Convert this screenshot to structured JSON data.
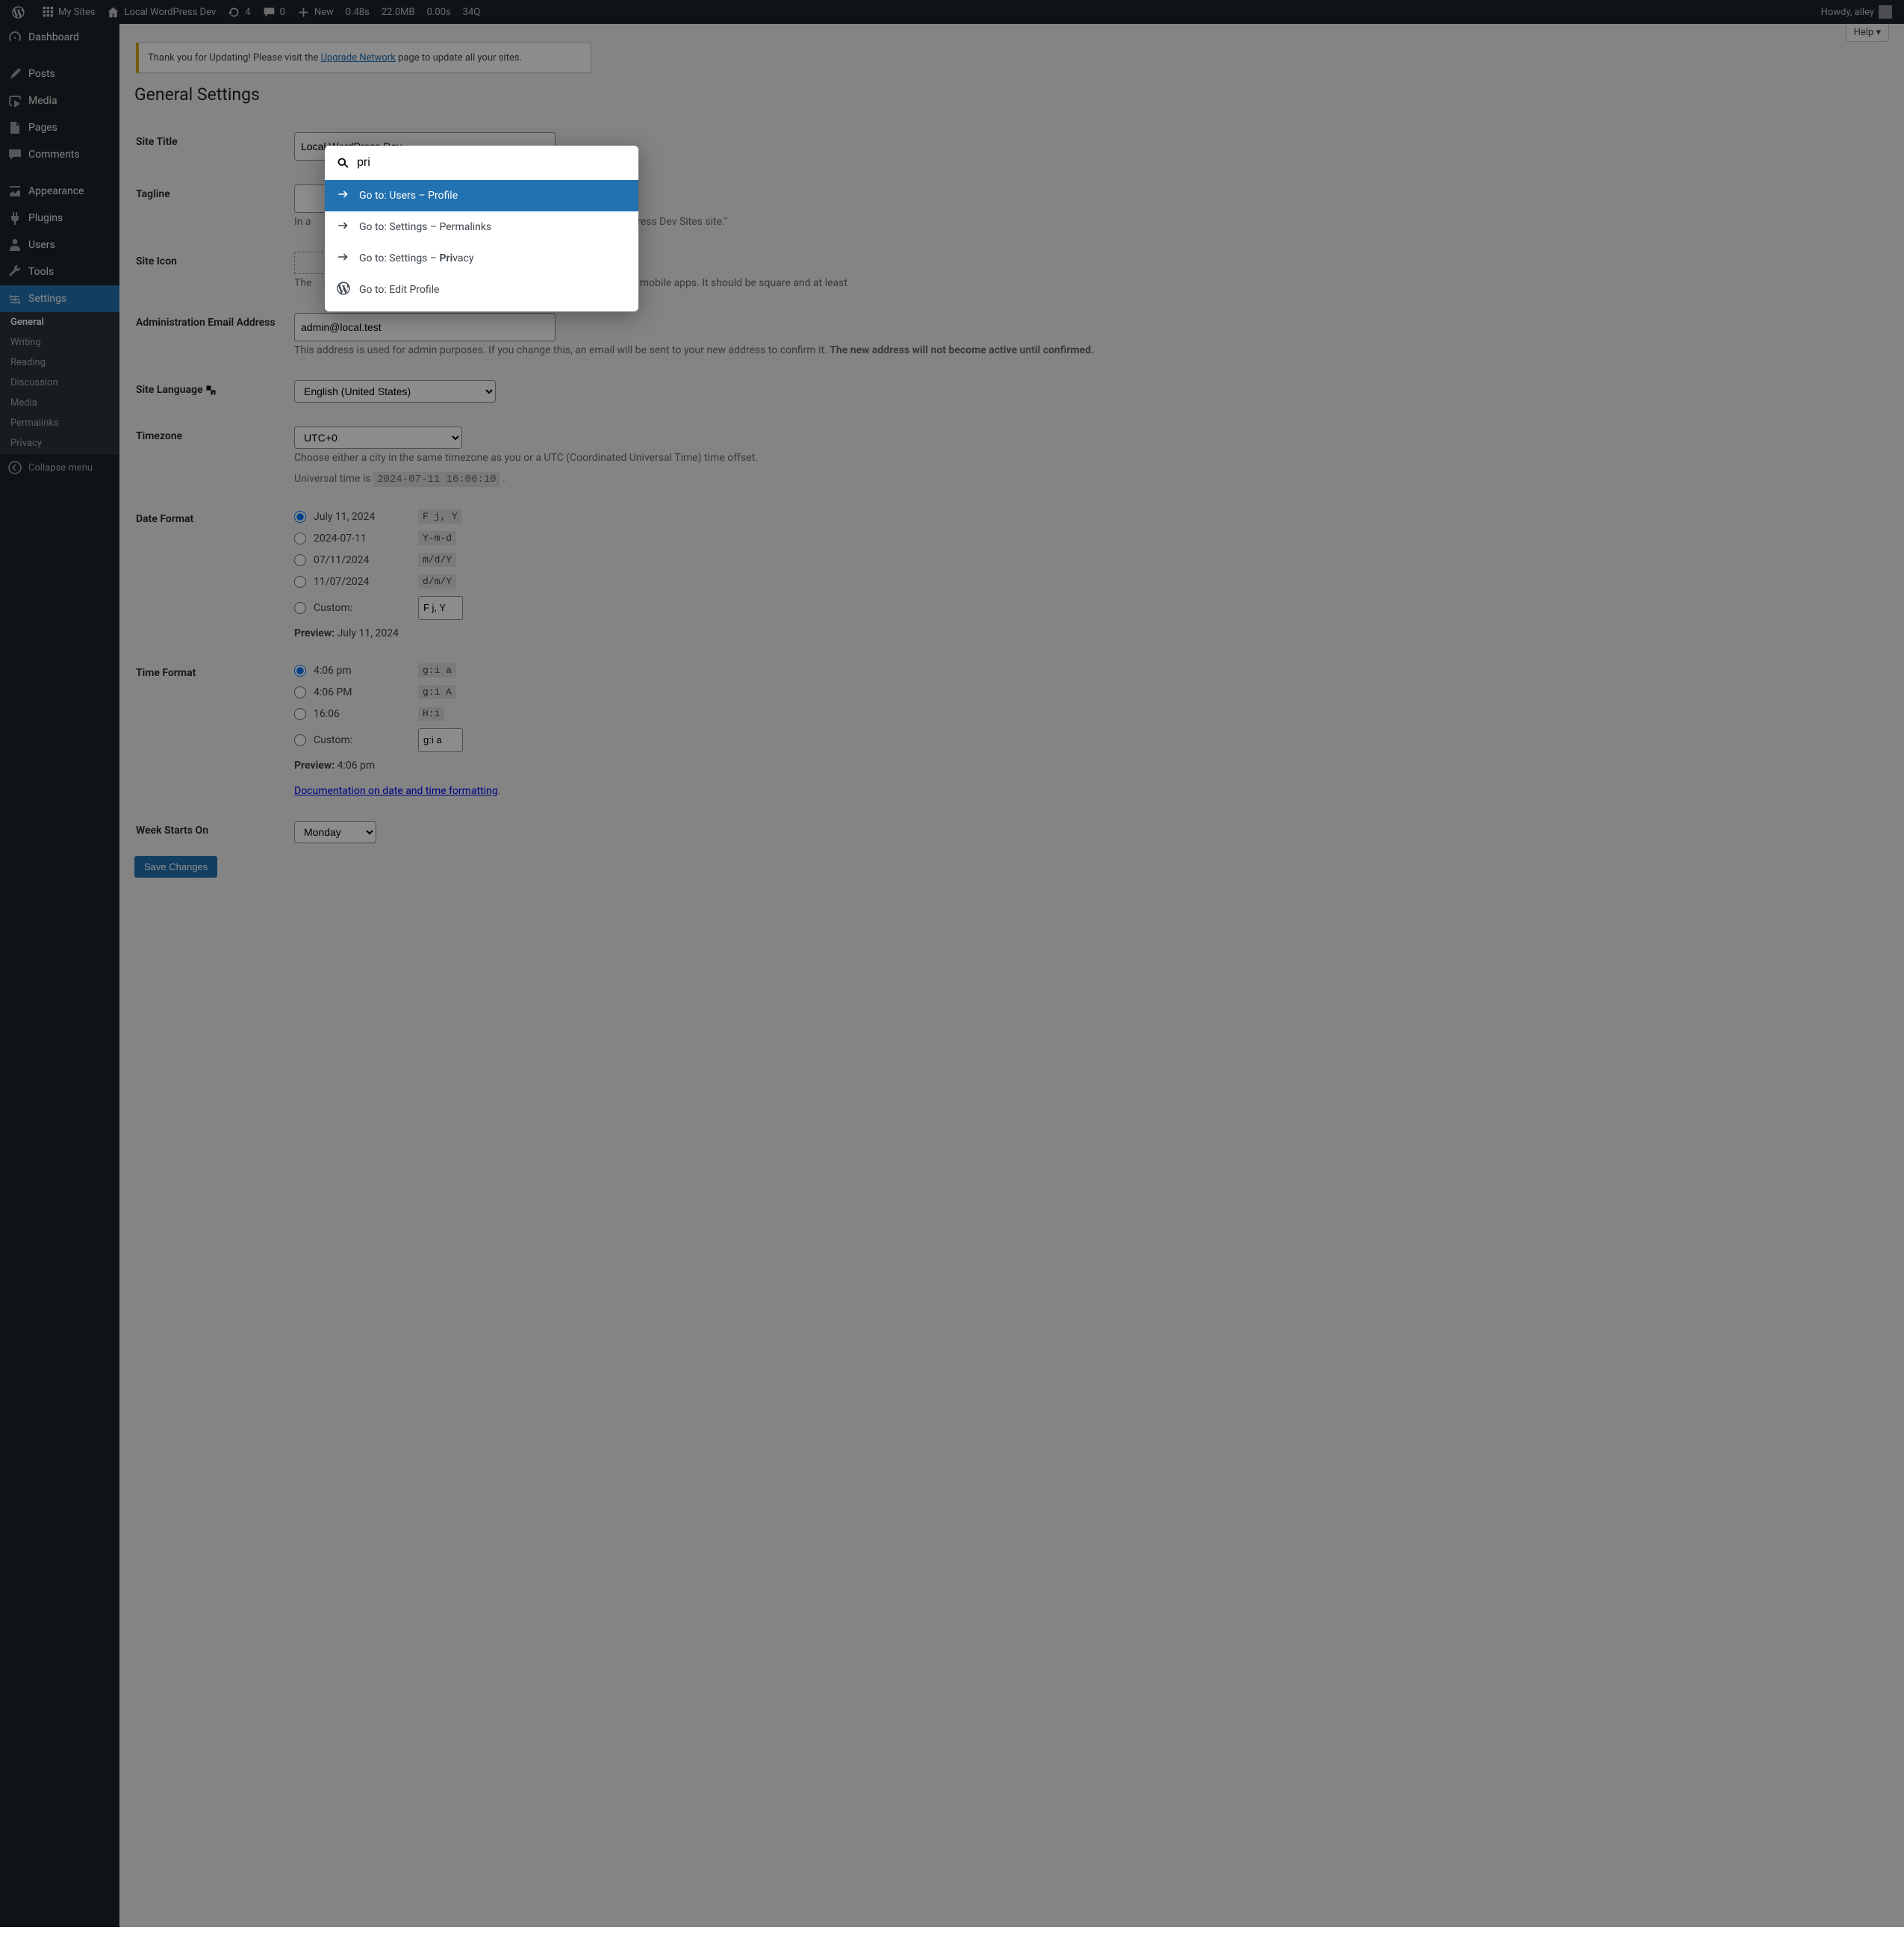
{
  "adminbar": {
    "my_sites": "My Sites",
    "site_name": "Local WordPress Dev",
    "updates_count": "4",
    "comments_count": "0",
    "new_label": "New",
    "perf_time": "0.48s",
    "perf_mem": "22.0MB",
    "perf_time2": "0.00s",
    "perf_q": "34Q",
    "howdy": "Howdy, alley"
  },
  "menu": {
    "dashboard": "Dashboard",
    "posts": "Posts",
    "media": "Media",
    "pages": "Pages",
    "comments": "Comments",
    "appearance": "Appearance",
    "plugins": "Plugins",
    "users": "Users",
    "tools": "Tools",
    "settings": "Settings",
    "submenu": {
      "general": "General",
      "writing": "Writing",
      "reading": "Reading",
      "discussion": "Discussion",
      "media": "Media",
      "permalinks": "Permalinks",
      "privacy": "Privacy"
    },
    "collapse": "Collapse menu"
  },
  "help": "Help",
  "notice": {
    "pre": "Thank you for Updating! Please visit the ",
    "link": "Upgrade Network",
    "post": " page to update all your sites."
  },
  "page_title": "General Settings",
  "form": {
    "site_title_label": "Site Title",
    "site_title_value": "Local WordPress Dev",
    "tagline_label": "Tagline",
    "tagline_desc_pre": "In a ",
    "tagline_desc_post": " Local WordPress Dev Sites site.\"",
    "site_icon_label": "Site Icon",
    "site_icon_desc_pre": "The",
    "site_icon_desc_post": "in the WordPress mobile apps. It should be square and at least",
    "admin_email_label": "Administration Email Address",
    "admin_email_value": "admin@local.test",
    "admin_email_desc": "This address is used for admin purposes. If you change this, an email will be sent to your new address to confirm it. ",
    "admin_email_desc_bold": "The new address will not become active until confirmed.",
    "site_lang_label": "Site Language",
    "site_lang_value": "English (United States)",
    "timezone_label": "Timezone",
    "timezone_value": "UTC+0",
    "timezone_desc": "Choose either a city in the same timezone as you or a UTC (Coordinated Universal Time) time offset.",
    "universal_time_pre": "Universal time is ",
    "universal_time_val": "2024-07-11 16:06:10",
    "date_format_label": "Date Format",
    "date_options": [
      {
        "example": "July 11, 2024",
        "fmt": "F j, Y",
        "checked": true
      },
      {
        "example": "2024-07-11",
        "fmt": "Y-m-d"
      },
      {
        "example": "07/11/2024",
        "fmt": "m/d/Y"
      },
      {
        "example": "11/07/2024",
        "fmt": "d/m/Y"
      }
    ],
    "custom_label": "Custom:",
    "date_custom_value": "F j, Y",
    "date_preview_label": "Preview:",
    "date_preview_value": "July 11, 2024",
    "time_format_label": "Time Format",
    "time_options": [
      {
        "example": "4:06 pm",
        "fmt": "g:i a",
        "checked": true
      },
      {
        "example": "4:06 PM",
        "fmt": "g:i A"
      },
      {
        "example": "16:06",
        "fmt": "H:i"
      }
    ],
    "time_custom_value": "g:i a",
    "time_preview_value": "4:06 pm",
    "doc_link": "Documentation on date and time formatting",
    "week_start_label": "Week Starts On",
    "week_start_value": "Monday",
    "save_button": "Save Changes"
  },
  "palette": {
    "query": "pri",
    "results": [
      {
        "label": "Go to: Users – Profile",
        "type": "arrow",
        "selected": true
      },
      {
        "label": "Go to: Settings – Permalinks",
        "type": "arrow"
      },
      {
        "label_pre": "Go to: Settings – ",
        "label_bold": "Pri",
        "label_post": "vacy",
        "type": "arrow"
      },
      {
        "label": "Go to: Edit Profile",
        "type": "wp"
      }
    ]
  }
}
